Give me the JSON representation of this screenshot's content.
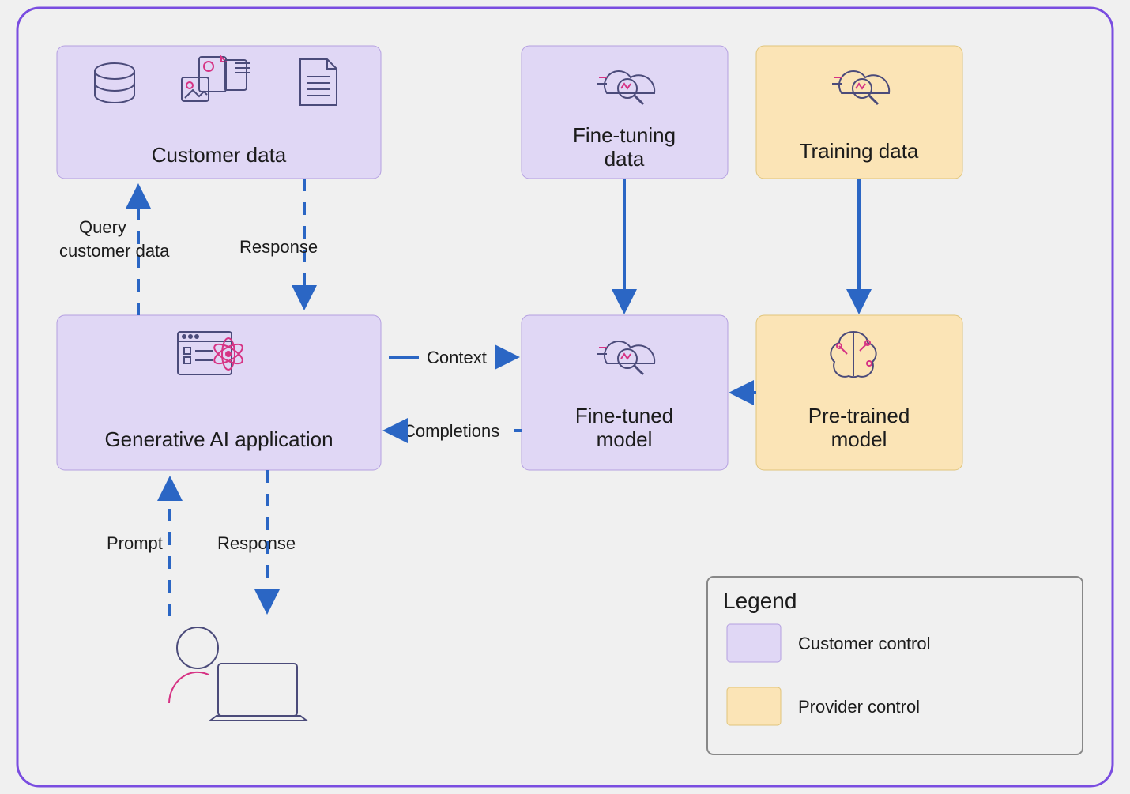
{
  "boxes": {
    "customer_data": "Customer data",
    "gen_ai_app": "Generative AI application",
    "fine_tuning_data": "Fine-tuning data",
    "training_data": "Training data",
    "fine_tuned_model": "Fine-tuned model",
    "pre_trained_model": "Pre-trained model"
  },
  "arrows": {
    "query_customer_data_l1": "Query",
    "query_customer_data_l2": "customer data",
    "response_cd_app": "Response",
    "context": "Context",
    "completions": "Completions",
    "prompt": "Prompt",
    "response_user": "Response"
  },
  "legend": {
    "title": "Legend",
    "customer_control": "Customer control",
    "provider_control": "Provider control"
  }
}
